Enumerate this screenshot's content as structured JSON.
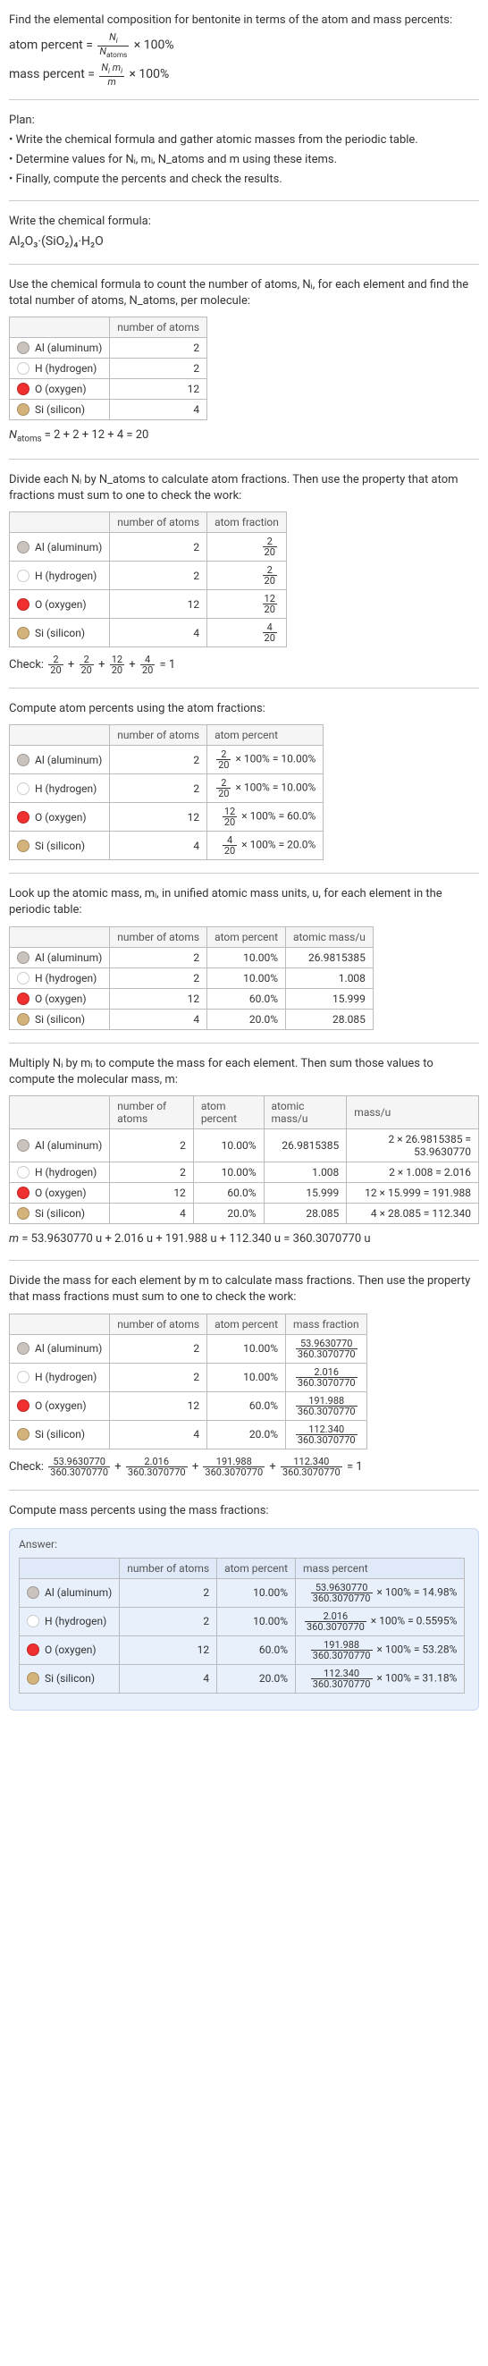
{
  "intro1": "Find the elemental composition for bentonite in terms of the atom and mass percents:",
  "eq_atom_percent": "atom percent = (Nᵢ / N_atoms) × 100%",
  "eq_mass_percent": "mass percent = (Nᵢ mᵢ / m) × 100%",
  "plan_label": "Plan:",
  "plan_items": [
    "• Write the chemical formula and gather atomic masses from the periodic table.",
    "• Determine values for Nᵢ, mᵢ, N_atoms and m using these items.",
    "• Finally, compute the percents and check the results."
  ],
  "write_formula": "Write the chemical formula:",
  "formula_html": "Al₂O₃·(SiO₂)₄·H₂O",
  "count_intro": "Use the chemical formula to count the number of atoms, Nᵢ, for each element and find the total number of atoms, N_atoms, per molecule:",
  "headers": {
    "n_atoms": "number of atoms",
    "atom_fraction": "atom fraction",
    "atom_percent": "atom percent",
    "atomic_mass": "atomic mass/u",
    "mass": "mass/u",
    "mass_fraction": "mass fraction",
    "mass_percent": "mass percent"
  },
  "elements": [
    {
      "sym": "Al",
      "name": "aluminum",
      "color": "#c9c2bd",
      "N": 2,
      "frac": "2/20",
      "pct": "10.00%",
      "amass": "26.9815385",
      "massexpr": "2 × 26.9815385 = 53.9630770",
      "mfrac": "53.9630770/360.3070770",
      "mpct": "53.9630770/360.3070770 × 100% = 14.98%"
    },
    {
      "sym": "H",
      "name": "hydrogen",
      "color": "#ffffff",
      "N": 2,
      "frac": "2/20",
      "pct": "10.00%",
      "amass": "1.008",
      "massexpr": "2 × 1.008 = 2.016",
      "mfrac": "2.016/360.3070770",
      "mpct": "2.016/360.3070770 × 100% = 0.5595%"
    },
    {
      "sym": "O",
      "name": "oxygen",
      "color": "#f03030",
      "N": 12,
      "frac": "12/20",
      "pct": "60.0%",
      "amass": "15.999",
      "massexpr": "12 × 15.999 = 191.988",
      "mfrac": "191.988/360.3070770",
      "mpct": "191.988/360.3070770 × 100% = 53.28%"
    },
    {
      "sym": "Si",
      "name": "silicon",
      "color": "#d4b37a",
      "N": 4,
      "frac": "4/20",
      "pct": "20.0%",
      "amass": "28.085",
      "massexpr": "4 × 28.085 = 112.340",
      "mfrac": "112.340/360.3070770",
      "mpct": "112.340/360.3070770 × 100% = 31.18%"
    }
  ],
  "natoms_line": "N_atoms = 2 + 2 + 12 + 4 = 20",
  "divide_intro": "Divide each Nᵢ by N_atoms to calculate atom fractions. Then use the property that atom fractions must sum to one to check the work:",
  "check1": "Check: 2/20 + 2/20 + 12/20 + 4/20 = 1",
  "percent_intro": "Compute atom percents using the atom fractions:",
  "pct_expr": [
    "2/20 × 100% = 10.00%",
    "2/20 × 100% = 10.00%",
    "12/20 × 100% = 60.0%",
    "4/20 × 100% = 20.0%"
  ],
  "amass_intro": "Look up the atomic mass, mᵢ, in unified atomic mass units, u, for each element in the periodic table:",
  "mass_intro": "Multiply Nᵢ by mᵢ to compute the mass for each element. Then sum those values to compute the molecular mass, m:",
  "m_line": "m = 53.9630770 u + 2.016 u + 191.988 u + 112.340 u = 360.3070770 u",
  "mfrac_intro": "Divide the mass for each element by m to calculate mass fractions. Then use the property that mass fractions must sum to one to check the work:",
  "check2": "Check: 53.9630770/360.3070770 + 2.016/360.3070770 + 191.988/360.3070770 + 112.340/360.3070770 = 1",
  "mpct_intro": "Compute mass percents using the mass fractions:",
  "answer_label": "Answer:"
}
